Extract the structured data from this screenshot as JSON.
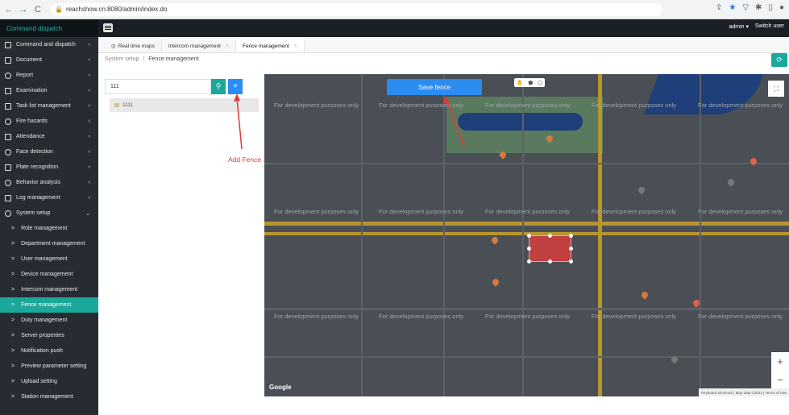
{
  "browser": {
    "url": "reachshow.cn:8080/admin/index.do",
    "back": "←",
    "forward": "→",
    "reload": "C"
  },
  "header": {
    "brand": "Command dispatch",
    "user": "admin ▾",
    "switch_user": "Switch user"
  },
  "sidebar": {
    "items": [
      {
        "label": "Command and dispatch",
        "icon": "monitor-icon"
      },
      {
        "label": "Document",
        "icon": "folder-icon"
      },
      {
        "label": "Report",
        "icon": "clock-icon"
      },
      {
        "label": "Examination",
        "icon": "clipboard-icon"
      },
      {
        "label": "Task list management",
        "icon": "list-icon"
      },
      {
        "label": "Fire hazards",
        "icon": "flame-icon"
      },
      {
        "label": "Attendance",
        "icon": "calendar-icon"
      },
      {
        "label": "Face detection",
        "icon": "face-icon"
      },
      {
        "label": "Plate recognition",
        "icon": "plate-icon"
      },
      {
        "label": "Behavior analysis",
        "icon": "behavior-icon"
      },
      {
        "label": "Log management",
        "icon": "log-icon"
      },
      {
        "label": "System setup",
        "icon": "gear-icon"
      }
    ],
    "sub_items": [
      "Role management",
      "Department management",
      "User management",
      "Device management",
      "Intercom management",
      "Fence management",
      "Duty management",
      "Server properties",
      "Notification push",
      "Preview parameter setting",
      "Upload setting",
      "Station management"
    ]
  },
  "tabs": [
    {
      "label": "Real time maps"
    },
    {
      "label": "Intercom management"
    },
    {
      "label": "Fence management"
    }
  ],
  "breadcrumb": {
    "parent": "System setup",
    "separator": "/",
    "current": "Fence management"
  },
  "panel": {
    "search_value": "111",
    "tree_item": "1111",
    "annotation": "Add Fence"
  },
  "map": {
    "save_button": "Save fence",
    "watermark": "For development purposes only",
    "google": "Google",
    "attribution": "Keyboard shortcuts | Map data ©2023 | Terms of Use"
  }
}
